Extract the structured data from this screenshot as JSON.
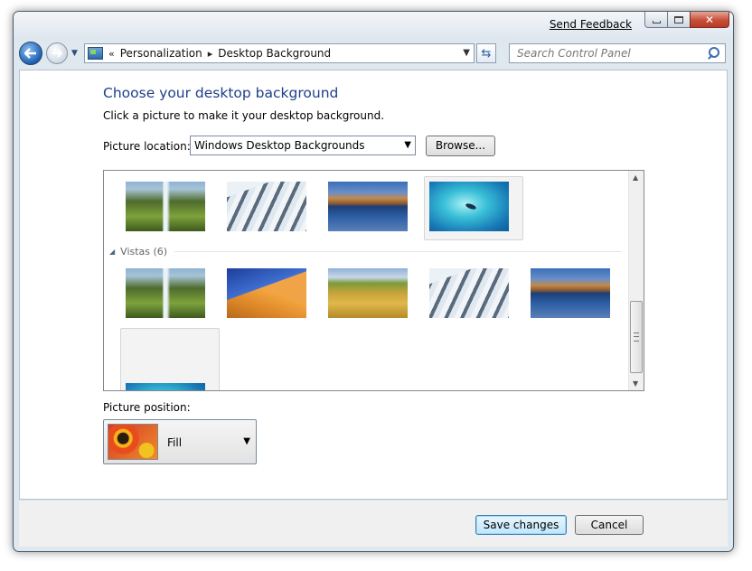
{
  "window": {
    "send_feedback": "Send Feedback"
  },
  "nav": {
    "breadcrumb_prefix": "«",
    "crumbs": [
      "Personalization",
      "Desktop Background"
    ],
    "search_placeholder": "Search Control Panel"
  },
  "page": {
    "title": "Choose your desktop background",
    "subtitle": "Click a picture to make it your desktop background.",
    "location_label": "Picture location:",
    "location_value": "Windows Desktop Backgrounds",
    "browse_label": "Browse...",
    "group_label": "Vistas (6)",
    "position_label": "Picture position:",
    "position_value": "Fill"
  },
  "pictures": {
    "row_top": [
      "waterfall",
      "mountains",
      "lake",
      "fish"
    ],
    "vistas": [
      "waterfall",
      "dune",
      "wheat",
      "mountains",
      "lake",
      "fish"
    ],
    "selected": "fish"
  },
  "footer": {
    "save_label": "Save changes",
    "cancel_label": "Cancel"
  },
  "colors": {
    "title": "#1e3f8a",
    "accent": "#3c7fb1"
  }
}
